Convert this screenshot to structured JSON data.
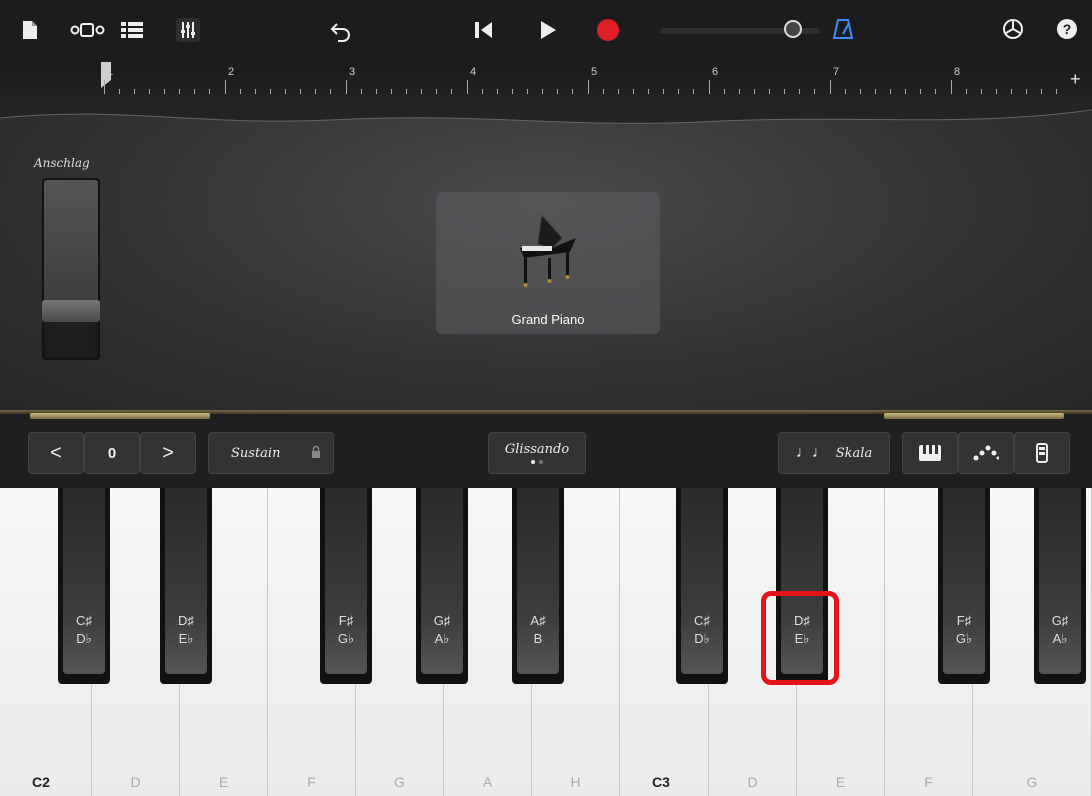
{
  "toolbar": {
    "icons": [
      "document-icon",
      "track-view-icon",
      "tracks-icon",
      "mixer-icon",
      "undo-icon",
      "rewind-icon",
      "play-icon",
      "record-icon",
      "metronome-icon",
      "settings-icon",
      "help-icon"
    ]
  },
  "ruler": {
    "bars": [
      "1",
      "2",
      "3",
      "4",
      "5",
      "6",
      "7",
      "8"
    ],
    "add_label": "+"
  },
  "velocity": {
    "label": "Anschlag"
  },
  "instrument": {
    "name": "Grand Piano"
  },
  "controls": {
    "octave_down": "<",
    "octave_value": "0",
    "octave_up": ">",
    "sustain": "Sustain",
    "glissando": "Glissando",
    "scale": "Skala",
    "scale_icon": "♩♩"
  },
  "white_keys": [
    "C2",
    "D",
    "E",
    "F",
    "G",
    "A",
    "H",
    "C3",
    "D",
    "E",
    "F",
    "G"
  ],
  "black_keys": [
    {
      "top": "C♯",
      "bottom": "D♭"
    },
    {
      "top": "D♯",
      "bottom": "E♭"
    },
    {
      "top": "F♯",
      "bottom": "G♭"
    },
    {
      "top": "G♯",
      "bottom": "A♭"
    },
    {
      "top": "A♯",
      "bottom": "B"
    },
    {
      "top": "C♯",
      "bottom": "D♭"
    },
    {
      "top": "D♯",
      "bottom": "E♭"
    },
    {
      "top": "F♯",
      "bottom": "G♭"
    },
    {
      "top": "G♯",
      "bottom": "A♭"
    }
  ],
  "colors": {
    "record": "#e01f26",
    "metronome": "#3b8cff",
    "highlight": "#e3131a"
  }
}
